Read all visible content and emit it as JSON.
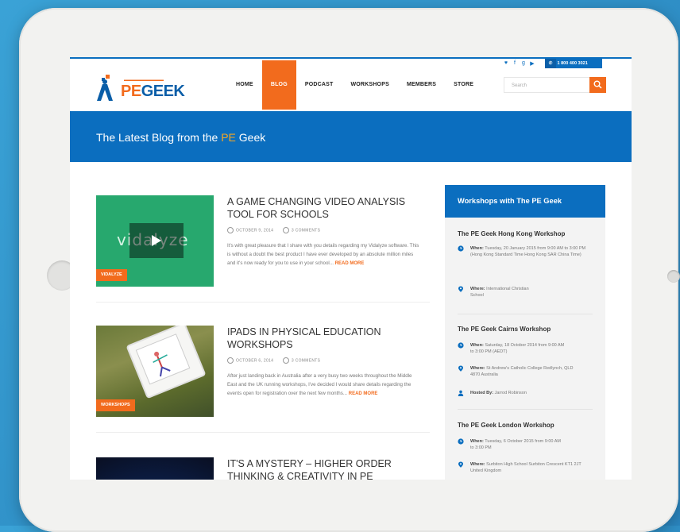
{
  "nav": {
    "items": [
      "HOME",
      "BLOG",
      "PODCAST",
      "WORKSHOPS",
      "MEMBERS",
      "STORE"
    ],
    "active_index": 1
  },
  "logo": {
    "pe": "PE",
    "geek": "GEEK"
  },
  "header": {
    "phone": "1 800 400 3021",
    "search_placeholder": "Search",
    "social_icons": [
      "twitter-icon",
      "facebook-icon",
      "google-plus-icon",
      "youtube-icon"
    ]
  },
  "banner": {
    "before": "The Latest Blog from the ",
    "pe": "PE",
    "after": " Geek"
  },
  "posts": [
    {
      "title": "A GAME CHANGING VIDEO ANALYSIS TOOL FOR SCHOOLS",
      "date": "OCTOBER 9, 2014",
      "comments": "3 COMMENTS",
      "excerpt": "It's with great pleasure that I share with you details regarding my Vidalyze software. This is without a doubt the best product I have ever developed by an absolute million miles and it's now ready for you to use in your school...",
      "read_more": "READ MORE",
      "category": "VIDALYZE",
      "thumb_word": "vidalyze"
    },
    {
      "title": "IPADS IN PHYSICAL EDUCATION WORKSHOPS",
      "date": "OCTOBER 6, 2014",
      "comments": "3 COMMENTS",
      "excerpt": "After just landing back in Australia after a very busy two weeks throughout the Middle East and the UK running workshops, I've decided I would share details regarding the events open for registration over the next few months...",
      "read_more": "READ MORE",
      "category": "WORKSHOPS"
    },
    {
      "title": "IT'S A MYSTERY – HIGHER ORDER THINKING & CREATIVITY IN PE"
    }
  ],
  "sidebar": {
    "title": "Workshops with The PE Geek",
    "workshops": [
      {
        "title": "The PE Geek Hong Kong Workshop",
        "when_label": "When:",
        "when": "Tuesday, 20 January 2015 from 9:00 AM to 3:00 PM (Hong Kong Standard Time Hong Kong SAR China Time)",
        "where_label": "Where:",
        "where": "International Christian School"
      },
      {
        "title": "The PE Geek Cairns Workshop",
        "when_label": "When:",
        "when": "Saturday, 18 October 2014 from 9:00 AM to 3:00 PM (AEDT)",
        "where_label": "Where:",
        "where": "St Andrew's Catholic College Redlynch, QLD 4870 Australia",
        "host_label": "Hosted By:",
        "host": "Jarrod Robinson"
      },
      {
        "title": "The PE Geek London Workshop",
        "when_label": "When:",
        "when": "Tuesday, 6 October 2015 from 9:00 AM to 3:00 PM",
        "where_label": "Where:",
        "where": "Surbiton High School Surbiton Crescent KT1 2JT United Kingdom"
      }
    ]
  },
  "colors": {
    "blue": "#0b6ebf",
    "orange": "#f26b1d"
  }
}
